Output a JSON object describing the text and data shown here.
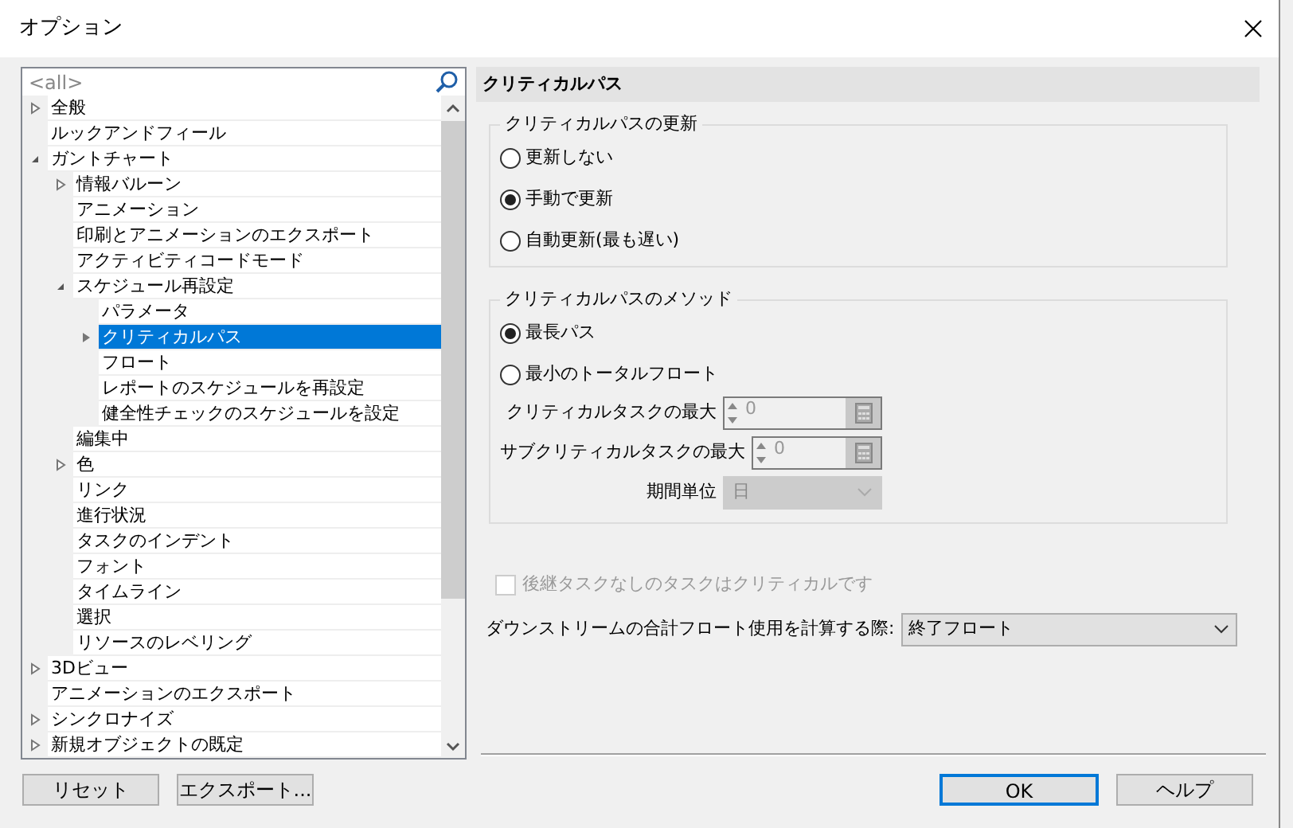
{
  "window": {
    "title": "オプション"
  },
  "tree": {
    "search": {
      "placeholder": "<all>"
    },
    "items": [
      {
        "label": "全般",
        "expanded": false,
        "selected": false
      },
      {
        "label": "ルックアンドフィール",
        "selected": false
      },
      {
        "label": "ガントチャート",
        "expanded": true,
        "selected": false,
        "children": [
          {
            "label": "情報バルーン",
            "expanded": false,
            "selected": false
          },
          {
            "label": "アニメーション",
            "selected": false
          },
          {
            "label": "印刷とアニメーションのエクスポート",
            "selected": false
          },
          {
            "label": "アクティビティコードモード",
            "selected": false
          },
          {
            "label": "スケジュール再設定",
            "expanded": true,
            "selected": false,
            "children": [
              {
                "label": "パラメータ",
                "selected": false
              },
              {
                "label": "クリティカルパス",
                "expanded": false,
                "selected": true
              },
              {
                "label": "フロート",
                "selected": false
              },
              {
                "label": "レポートのスケジュールを再設定",
                "selected": false
              },
              {
                "label": "健全性チェックのスケジュールを設定",
                "selected": false
              }
            ]
          },
          {
            "label": "編集中",
            "selected": false
          },
          {
            "label": "色",
            "expanded": false,
            "selected": false
          },
          {
            "label": "リンク",
            "selected": false
          },
          {
            "label": "進行状況",
            "selected": false
          },
          {
            "label": "タスクのインデント",
            "selected": false
          },
          {
            "label": "フォント",
            "selected": false
          },
          {
            "label": "タイムライン",
            "selected": false
          },
          {
            "label": "選択",
            "selected": false
          },
          {
            "label": "リソースのレベリング",
            "selected": false
          }
        ]
      },
      {
        "label": "3Dビュー",
        "expanded": false,
        "selected": false
      },
      {
        "label": "アニメーションのエクスポート",
        "selected": false
      },
      {
        "label": "シンクロナイズ",
        "expanded": false,
        "selected": false
      },
      {
        "label": "新規オブジェクトの既定",
        "expanded": false,
        "selected": false
      }
    ]
  },
  "panel": {
    "title": "クリティカルパス",
    "update_group": {
      "legend": "クリティカルパスの更新",
      "options": [
        {
          "label": "更新しない",
          "selected": false
        },
        {
          "label": "手動で更新",
          "selected": true
        },
        {
          "label": "自動更新(最も遅い)",
          "selected": false
        }
      ]
    },
    "method_group": {
      "legend": "クリティカルパスのメソッド",
      "options": [
        {
          "label": "最長パス",
          "selected": true
        },
        {
          "label": "最小のトータルフロート",
          "selected": false
        }
      ],
      "fields": [
        {
          "kind": "spin",
          "label": "クリティカルタスクの最大",
          "value": "0",
          "disabled": true
        },
        {
          "kind": "spin",
          "label": "サブクリティカルタスクの最大",
          "value": "0",
          "disabled": true
        },
        {
          "kind": "select",
          "label": "期間単位",
          "value": "日",
          "disabled": true
        }
      ]
    },
    "checkbox": {
      "label": "後継タスクなしのタスクはクリティカルです",
      "checked": false,
      "disabled": true
    },
    "downstream": {
      "label": "ダウンストリームの合計フロート使用を計算する際:",
      "value": "終了フロート"
    }
  },
  "buttons_left": [
    {
      "label": "リセット"
    },
    {
      "label": "エクスポート..."
    }
  ],
  "buttons_right": [
    {
      "label": "OK",
      "default": true
    },
    {
      "label": "ヘルプ",
      "default": false
    }
  ]
}
